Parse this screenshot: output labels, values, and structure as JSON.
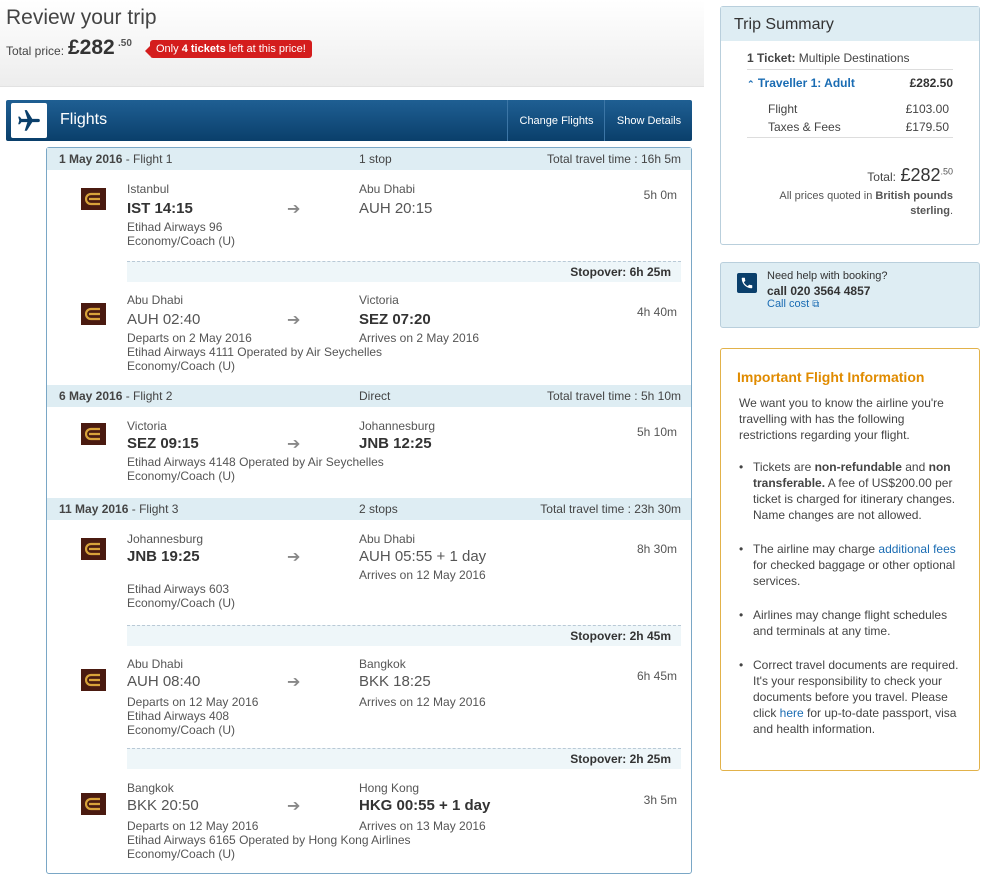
{
  "header": {
    "title": "Review your trip",
    "total_label": "Total price:",
    "total_main": "£282",
    "total_decimal": ".50",
    "badge_prefix": "Only ",
    "badge_bold": "4 tickets",
    "badge_suffix": " left at this price!"
  },
  "flights_bar": {
    "title": "Flights",
    "change_label": "Change Flights",
    "details_label": "Show Details"
  },
  "sections": [
    {
      "date": "1 May 2016",
      "flight": " - Flight 1",
      "stops": "1 stop",
      "total": "Total travel time : 16h 5m",
      "legs": [
        {
          "from_city": "Istanbul",
          "from_time": "IST 14:15",
          "to_city": "Abu Dhabi",
          "to_time": "AUH 20:15",
          "duration": "5h 0m",
          "lines": [
            "Etihad Airways 96",
            "Economy/Coach (U)"
          ]
        },
        {
          "stopover": "Stopover: 6h 25m"
        },
        {
          "from_city": "Abu Dhabi",
          "from_time": "AUH 02:40",
          "to_city": "Victoria",
          "to_time": "SEZ 07:20",
          "duration": "4h 40m",
          "from_note": "Departs on 2 May 2016",
          "to_note": "Arrives on 2 May 2016",
          "lines": [
            "Etihad Airways 4111 Operated by Air Seychelles",
            "Economy/Coach (U)"
          ]
        }
      ]
    },
    {
      "date": "6 May 2016",
      "flight": " - Flight 2",
      "stops": "Direct",
      "total": "Total travel time : 5h 10m",
      "legs": [
        {
          "from_city": "Victoria",
          "from_time": "SEZ 09:15",
          "to_city": "Johannesburg",
          "to_time": "JNB 12:25",
          "duration": "5h 10m",
          "lines": [
            "Etihad Airways 4148 Operated by Air Seychelles",
            "Economy/Coach (U)"
          ]
        }
      ]
    },
    {
      "date": "11 May 2016",
      "flight": " - Flight 3",
      "stops": "2 stops",
      "total": "Total travel time : 23h 30m",
      "legs": [
        {
          "from_city": "Johannesburg",
          "from_time": "JNB 19:25",
          "to_city": "Abu Dhabi",
          "to_time": "AUH 05:55 + 1 day",
          "duration": "8h 30m",
          "to_note": "Arrives on 12 May 2016",
          "lines": [
            "Etihad Airways 603",
            "Economy/Coach (U)"
          ]
        },
        {
          "stopover": "Stopover: 2h 45m"
        },
        {
          "from_city": "Abu Dhabi",
          "from_time": "AUH 08:40",
          "to_city": "Bangkok",
          "to_time": "BKK 18:25",
          "duration": "6h 45m",
          "from_note": "Departs on 12 May 2016",
          "to_note": "Arrives on 12 May 2016",
          "lines": [
            "Etihad Airways 408",
            "Economy/Coach (U)"
          ]
        },
        {
          "stopover": "Stopover: 2h 25m"
        },
        {
          "from_city": "Bangkok",
          "from_time": "BKK 20:50",
          "to_city": "Hong Kong",
          "to_time": "HKG 00:55 + 1 day",
          "duration": "3h 5m",
          "from_note": "Departs on 12 May 2016",
          "to_note": "Arrives on 13 May 2016",
          "lines": [
            "Etihad Airways 6165 Operated by Hong Kong Airlines",
            "Economy/Coach (U)"
          ]
        }
      ]
    }
  ],
  "summary": {
    "title": "Trip Summary",
    "ticket_bold": "1 Ticket:",
    "ticket_rest": " Multiple Destinations",
    "traveller": "Traveller 1: Adult",
    "traveller_price": "£282.50",
    "flight_label": "Flight",
    "flight_price": "£103.00",
    "taxes_label": "Taxes & Fees",
    "taxes_price": "£179.50",
    "total_label": "Total:",
    "total_main": "£282",
    "total_dec": ".50",
    "note_a": "All prices quoted in ",
    "note_b": "British pounds",
    "note_c": "sterling",
    "note_d": "."
  },
  "help": {
    "line1": "Need help with booking?",
    "line2": "call 020 3564 4857",
    "line3": "Call cost"
  },
  "info": {
    "title": "Important Flight Information",
    "intro": "We want you to know the airline you're travelling with has the following restrictions regarding your flight.",
    "b1_a": "Tickets are ",
    "b1_b": "non-refundable",
    "b1_c": " and ",
    "b1_d": "non transferable.",
    "b1_e": " A fee of US$200.00 per ticket is charged for itinerary changes. Name changes are not allowed.",
    "b2_a": "The airline may charge ",
    "b2_link": "additional fees",
    "b2_b": " for checked baggage or other optional services.",
    "b3": "Airlines may change flight schedules and terminals at any time.",
    "b4_a": "Correct travel documents are required. It's your responsibility to check your documents before you travel. Please click ",
    "b4_link": "here",
    "b4_b": " for up-to-date passport, visa and health information."
  },
  "colors": {
    "bar": "#0a3f6b",
    "badge": "#d41d1d",
    "info_title": "#e08b00",
    "link": "#1a6cb3"
  },
  "icons": {
    "plane": "plane-icon",
    "airline": "etihad-logo-icon",
    "phone": "phone-icon"
  }
}
